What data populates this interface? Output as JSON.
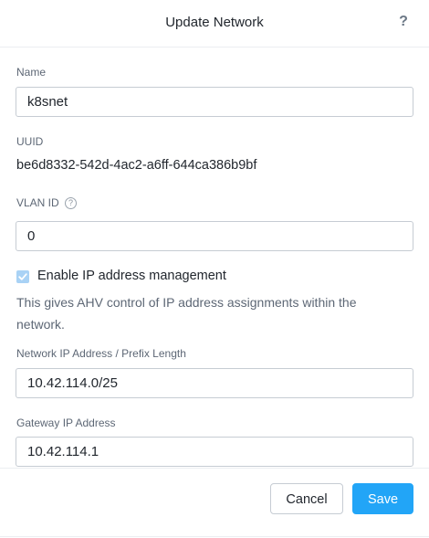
{
  "dialog": {
    "title": "Update Network",
    "help_glyph": "?"
  },
  "form": {
    "name": {
      "label": "Name",
      "value": "k8snet"
    },
    "uuid": {
      "label": "UUID",
      "value": "be6d8332-542d-4ac2-a6ff-644ca386b9bf"
    },
    "vlan": {
      "label": "VLAN ID",
      "info_glyph": "?",
      "value": "0"
    },
    "ip_management": {
      "checked": true,
      "label": "Enable IP address management",
      "description": "This gives AHV control of IP address assignments within the network."
    },
    "network_ip": {
      "label": "Network IP Address / Prefix Length",
      "value": "10.42.114.0/25"
    },
    "gateway_ip": {
      "label": "Gateway IP Address",
      "value": "10.42.114.1"
    }
  },
  "footer": {
    "cancel_label": "Cancel",
    "save_label": "Save"
  },
  "colors": {
    "primary": "#22a5f7",
    "checkbox_fill": "#a9d2f5",
    "border": "#c6ccd3",
    "muted_text": "#5d6775"
  },
  "icons": {
    "help": "question-mark-icon",
    "info": "info-circle-icon",
    "check": "checkmark-icon"
  }
}
